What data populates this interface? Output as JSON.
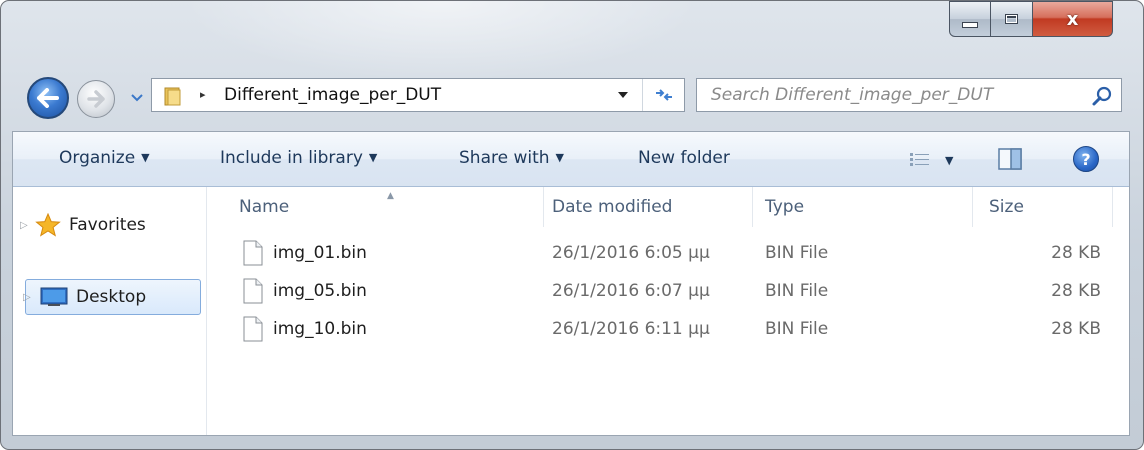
{
  "window": {
    "caption_buttons": {
      "minimize": "minimize",
      "maximize": "maximize",
      "close": "x"
    }
  },
  "nav": {
    "address": {
      "separator": "▸",
      "path": "Different_image_per_DUT"
    },
    "search": {
      "placeholder": "Search Different_image_per_DUT"
    }
  },
  "toolbar": {
    "organize_label": "Organize",
    "include_label": "Include in library",
    "share_label": "Share with",
    "new_folder_label": "New folder",
    "dropdown_arrow": "▼",
    "help_glyph": "?"
  },
  "sidebar": {
    "items": [
      {
        "label": "Favorites",
        "icon": "star-icon"
      },
      {
        "label": "Desktop",
        "icon": "desktop-icon",
        "selected": true
      }
    ]
  },
  "columns": {
    "name": "Name",
    "date": "Date modified",
    "type": "Type",
    "size": "Size"
  },
  "files": [
    {
      "name": "img_01.bin",
      "date": "26/1/2016 6:05 μμ",
      "type": "BIN File",
      "size": "28 KB"
    },
    {
      "name": "img_05.bin",
      "date": "26/1/2016 6:07 μμ",
      "type": "BIN File",
      "size": "28 KB"
    },
    {
      "name": "img_10.bin",
      "date": "26/1/2016 6:11 μμ",
      "type": "BIN File",
      "size": "28 KB"
    }
  ],
  "colors": {
    "accent": "#1e395b",
    "selection_border": "#84acdd",
    "back_button": "#3b7ad0",
    "close_button": "#c13a22"
  }
}
